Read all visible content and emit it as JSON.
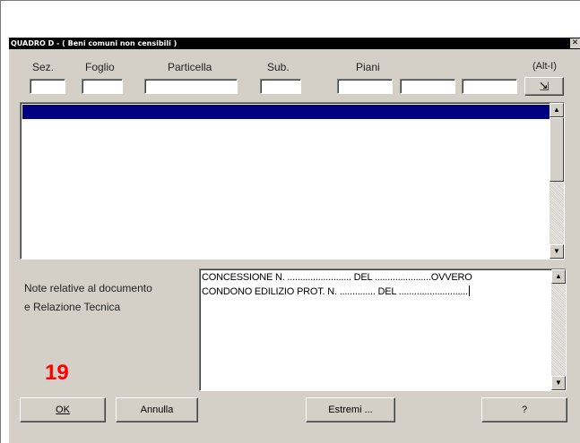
{
  "window": {
    "title": "QUADRO D  - ( Beni comuni non censibili )",
    "close_glyph": "✕"
  },
  "header": {
    "labels": {
      "sez": "Sez.",
      "foglio": "Foglio",
      "particella": "Particella",
      "sub": "Sub.",
      "piani": "Piani",
      "shortcut": "(Alt-I)"
    },
    "fields": {
      "sez": "",
      "foglio": "",
      "particella": "",
      "sub": "",
      "piani_1": "",
      "piani_2": "",
      "piani_3": ""
    },
    "insert_button_icon": "insert-arrow-icon",
    "insert_glyph": "⇲"
  },
  "list": {
    "rows": [],
    "selected_row_color": "#000080"
  },
  "notes": {
    "label_line1": "Note relative al documento",
    "label_line2": "e Relazione Tecnica",
    "text_line1": "CONCESSIONE N. ......................... DEL ......................OVVERO",
    "text_line2": "CONDONO EDILIZIO PROT. N. .............. DEL ..........................."
  },
  "annotation": {
    "number": "19",
    "color": "#ff0000"
  },
  "buttons": {
    "ok": "OK",
    "annulla": "Annulla",
    "estremi": "Estremi ...",
    "help": "?"
  },
  "scroll_glyphs": {
    "up": "▲",
    "down": "▼"
  }
}
